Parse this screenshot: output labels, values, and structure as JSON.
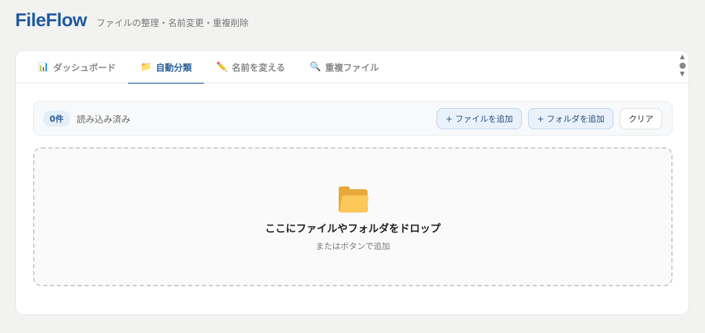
{
  "header": {
    "logo": "FileFlow",
    "subtitle": "ファイルの整理・名前変更・重複削除"
  },
  "tabs": [
    {
      "icon": "📊",
      "label": "ダッシュボード"
    },
    {
      "icon": "📁",
      "label": "自動分類"
    },
    {
      "icon": "✏️",
      "label": "名前を変える"
    },
    {
      "icon": "🔍",
      "label": "重複ファイル"
    }
  ],
  "toolbar": {
    "count": "0件",
    "loaded": "読み込み済み",
    "add_files": "+ ファイルを追加",
    "add_folder": "+ フォルダを追加",
    "clear": "クリア"
  },
  "dropzone": {
    "title": "ここにファイルやフォルダをドロップ",
    "subtitle": "またはボタンで追加"
  }
}
